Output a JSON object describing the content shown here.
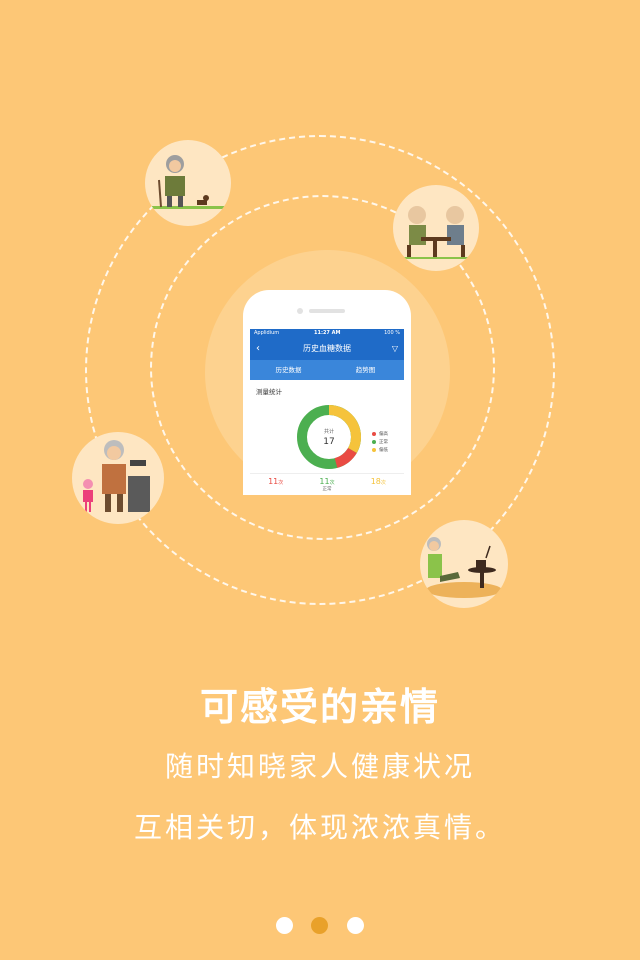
{
  "phone": {
    "status_carrier": "Applidium",
    "status_time": "11:27 AM",
    "status_battery": "100 %",
    "nav_title": "历史血糖数据",
    "tabs": [
      "历史数据",
      "趋势图"
    ],
    "stats_title": "测量统计",
    "total_label": "共计",
    "total_value": "17",
    "legend": [
      {
        "label": "偏高",
        "color": "#E94B43"
      },
      {
        "label": "正常",
        "color": "#4CAF50"
      },
      {
        "label": "偏低",
        "color": "#F5C33B"
      }
    ],
    "counts": [
      {
        "value": "11",
        "unit": "次",
        "sub": "",
        "color": "#E94B43"
      },
      {
        "value": "11",
        "unit": "次",
        "sub": "正常",
        "color": "#4CAF50"
      },
      {
        "value": "18",
        "unit": "次",
        "sub": "",
        "color": "#F5C33B"
      }
    ]
  },
  "headline": "可感受的亲情",
  "line1": "随时知晓家人健康状况",
  "line2": "互相关切，体现浓浓真情。",
  "pagination": {
    "count": 3,
    "active": 1
  }
}
